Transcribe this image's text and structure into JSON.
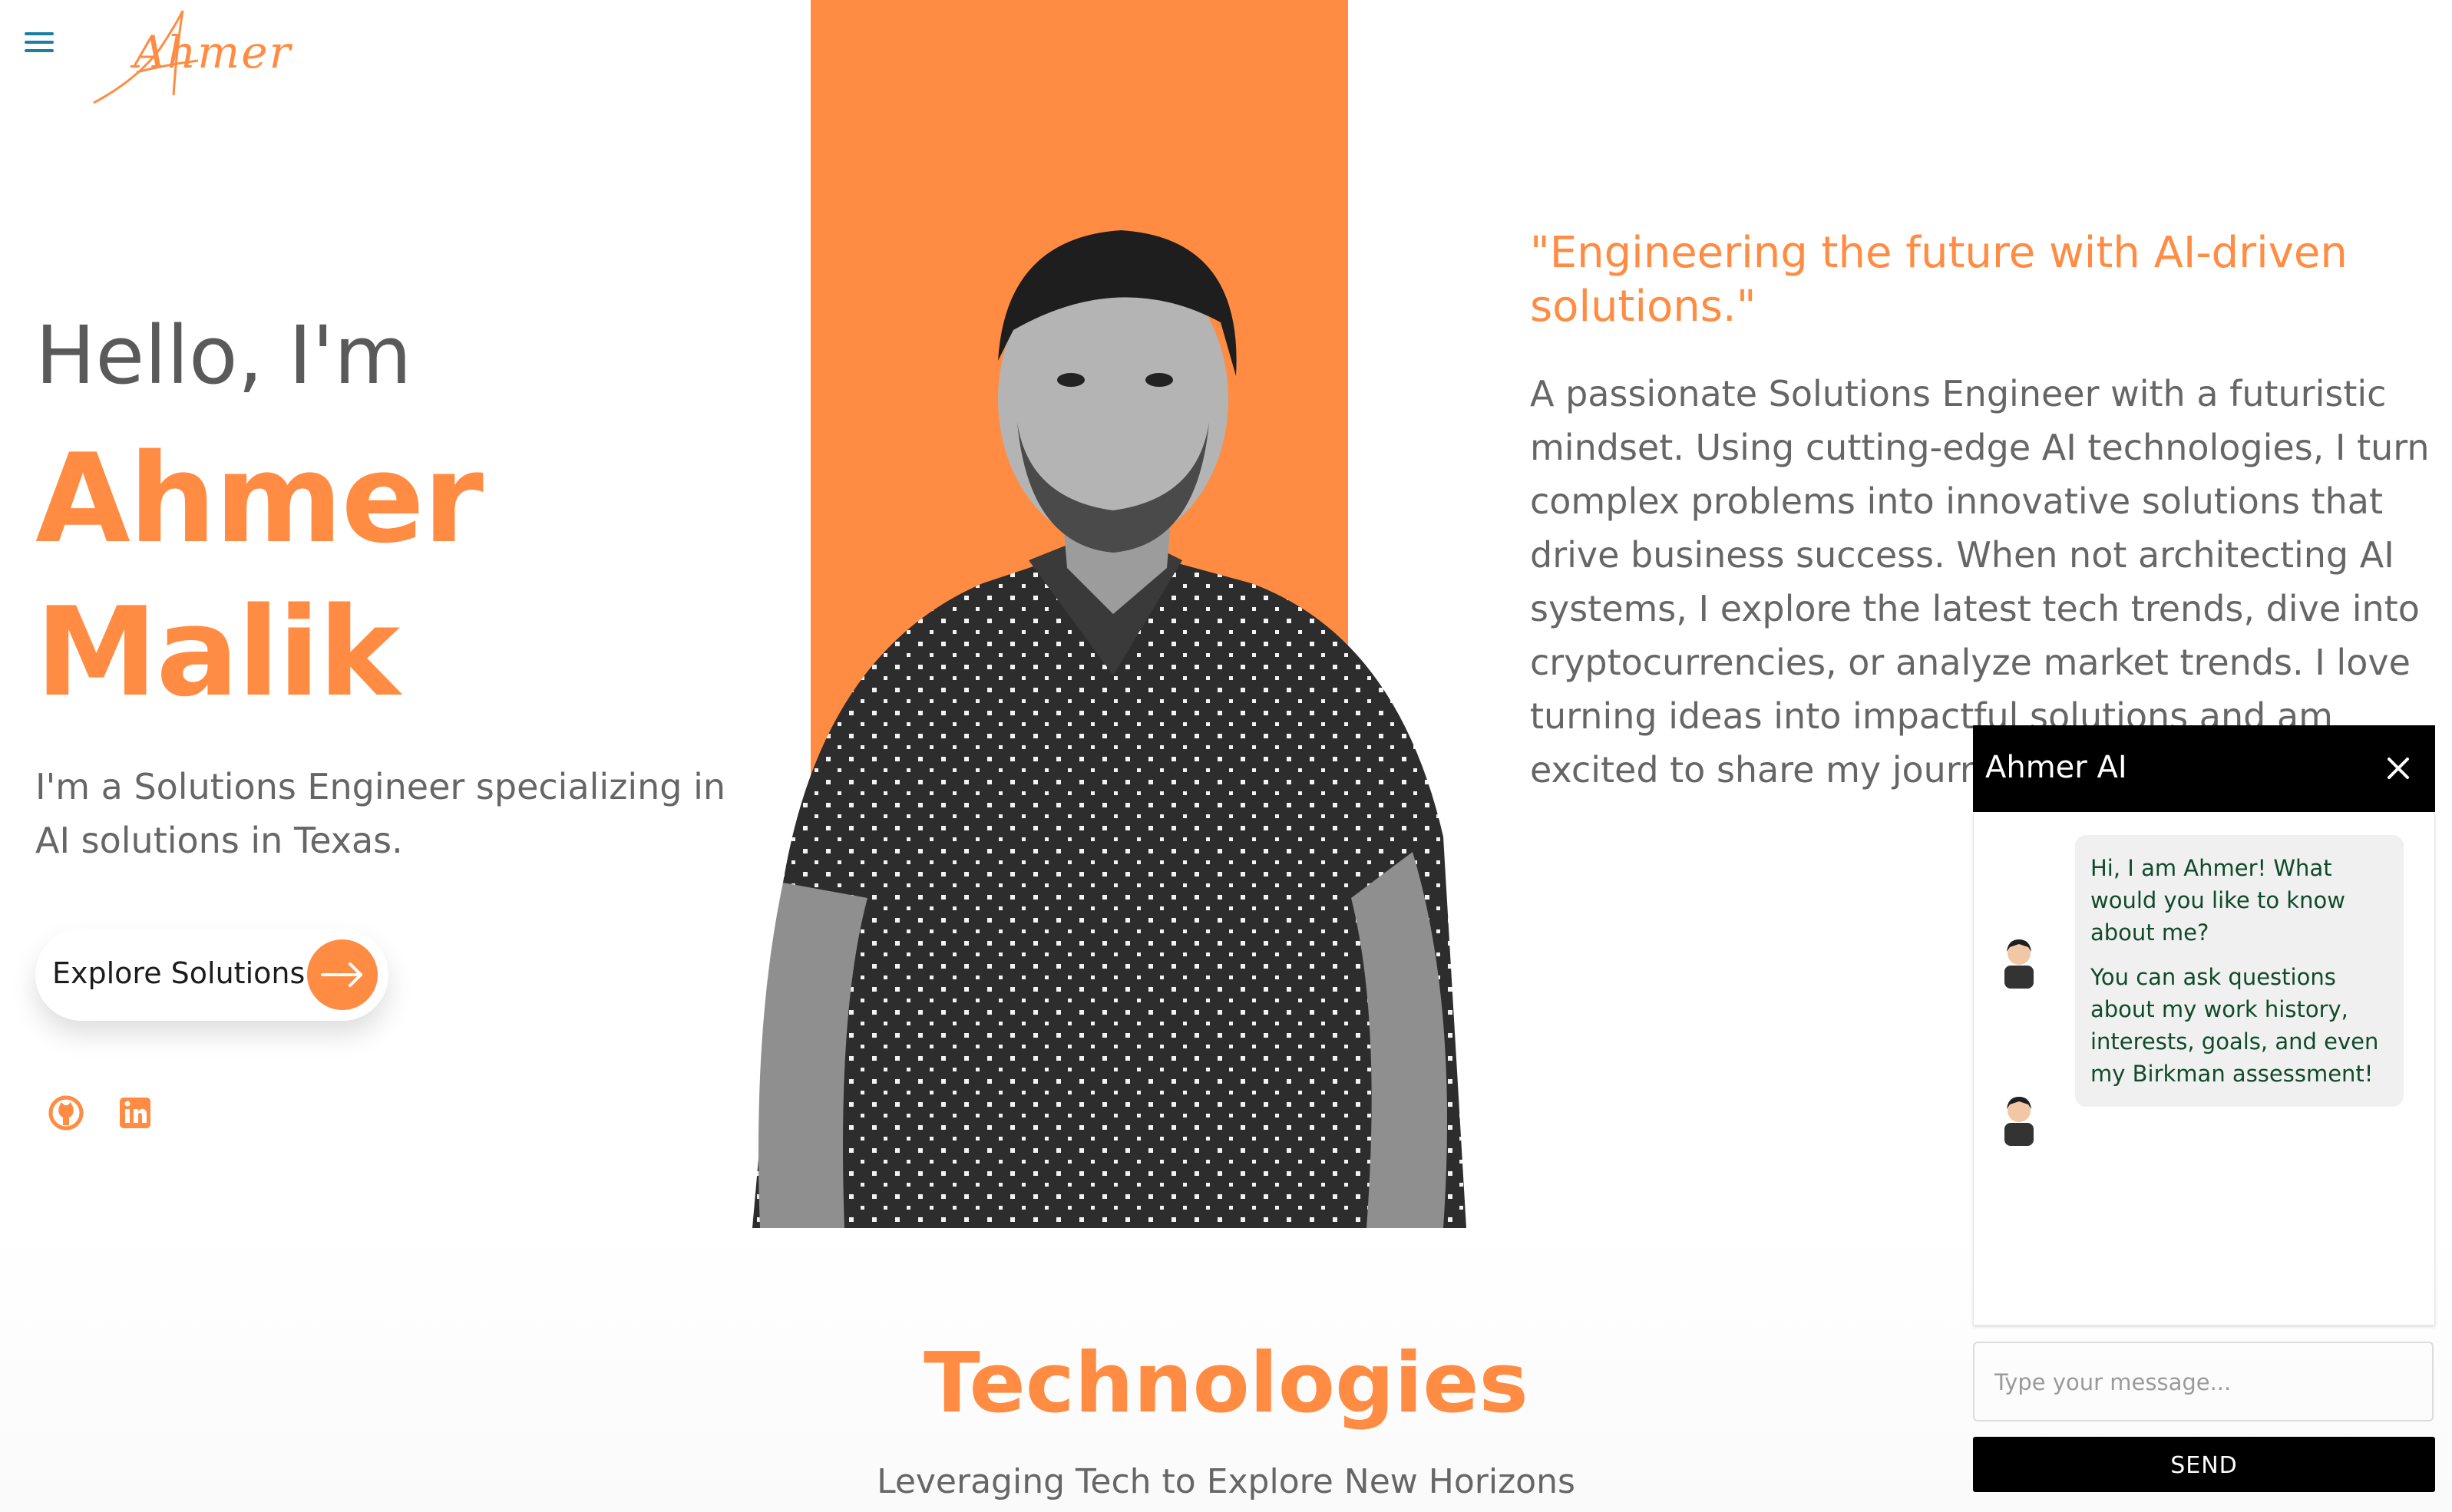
{
  "nav": {
    "menu_icon": "hamburger-icon",
    "logo_text": "Ahmer"
  },
  "hero": {
    "greeting": "Hello, I'm",
    "name_line1": "Ahmer",
    "name_line2": "Malik",
    "intro": "I'm a Solutions Engineer specializing in AI solutions in Texas.",
    "cta_label": "Explore Solutions!",
    "cta_icon": "arrow-right-icon",
    "social": [
      {
        "name": "github-icon"
      },
      {
        "name": "linkedin-icon"
      }
    ]
  },
  "about": {
    "quote": "\"Engineering the future with AI-driven solutions.\"",
    "text": "A passionate Solutions Engineer with a futuristic mindset. Using cutting-edge AI technologies, I turn complex problems into innovative solutions that drive business success. When not architecting AI systems, I explore the latest tech trends, dive into cryptocurrencies, or analyze market trends. I love turning ideas into impactful solutions and am excited to share my journey"
  },
  "technologies": {
    "title": "Technologies",
    "subtitle": "Leveraging Tech to Explore New Horizons"
  },
  "chat": {
    "title": "Ahmer AI",
    "close_icon": "close-icon",
    "messages": [
      {
        "text": "Hi, I am Ahmer! What would you like to know about me?"
      },
      {
        "text": "You can ask questions about my work history, interests, goals, and even my Birkman assessment!"
      }
    ],
    "input_placeholder": "Type your message...",
    "send_label": "SEND"
  },
  "colors": {
    "accent": "#ff8c42",
    "text": "#666666",
    "chat_header": "#000000",
    "bubble": "#f0f0f0",
    "bubble_text": "#0f4a2b",
    "menu_icon": "#1a7fa0"
  }
}
